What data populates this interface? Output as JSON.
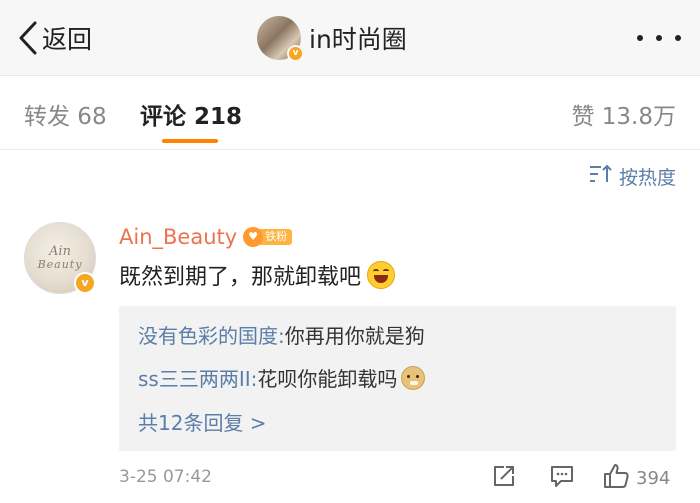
{
  "header": {
    "back_label": "返回",
    "title": "in时尚圈",
    "verified_badge": "v"
  },
  "tabs": {
    "forward": "转发 68",
    "comment": "评论 218",
    "like": "赞 13.8万",
    "active": "comment",
    "accent_color": "#ff8200"
  },
  "sort": {
    "label": "按热度",
    "icon": "sort-icon"
  },
  "comment": {
    "username": "Ain_Beauty",
    "fan_badge": "铁粉",
    "avatar_text": [
      "Ain",
      "Beauty"
    ],
    "text": "既然到期了，那就卸载吧",
    "emoji": "laughing-emoji",
    "verified_badge": "v",
    "replies": [
      {
        "name": "没有色彩的国度:",
        "text": " 你再用你就是狗",
        "emoji": ""
      },
      {
        "name": "ss三三两两II:",
        "text": " 花呗你能卸载吗",
        "emoji": "doge-emoji"
      }
    ],
    "more_replies": "共12条回复 >",
    "time": "3-25 07:42",
    "like_count": "394"
  },
  "colors": {
    "username": "#eb7350",
    "link": "#5b7ea8",
    "verified": "#f5a623"
  }
}
